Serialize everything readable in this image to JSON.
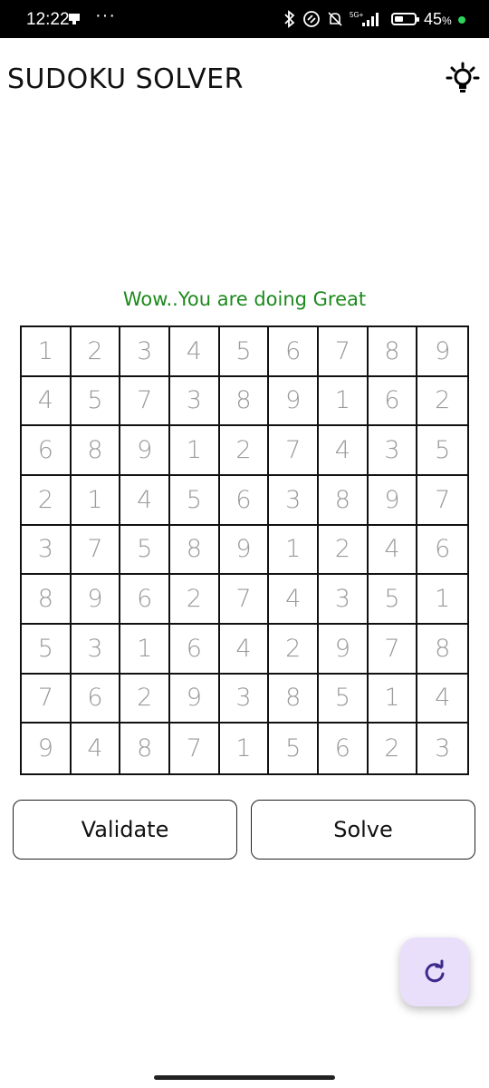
{
  "status_bar": {
    "time": "12:22",
    "dots": "···",
    "network": "5G+",
    "battery_percent": "45",
    "battery_symbol": "%",
    "battery_level": 0.45,
    "dot_color": "#2ed35a"
  },
  "header": {
    "title": "SUDOKU SOLVER",
    "theme_icon": "lightbulb-icon"
  },
  "message": {
    "text": "Wow..You are doing Great",
    "color": "#1c8a1c"
  },
  "board": {
    "rows": [
      [
        "1",
        "2",
        "3",
        "4",
        "5",
        "6",
        "7",
        "8",
        "9"
      ],
      [
        "4",
        "5",
        "7",
        "3",
        "8",
        "9",
        "1",
        "6",
        "2"
      ],
      [
        "6",
        "8",
        "9",
        "1",
        "2",
        "7",
        "4",
        "3",
        "5"
      ],
      [
        "2",
        "1",
        "4",
        "5",
        "6",
        "3",
        "8",
        "9",
        "7"
      ],
      [
        "3",
        "7",
        "5",
        "8",
        "9",
        "1",
        "2",
        "4",
        "6"
      ],
      [
        "8",
        "9",
        "6",
        "2",
        "7",
        "4",
        "3",
        "5",
        "1"
      ],
      [
        "5",
        "3",
        "1",
        "6",
        "4",
        "2",
        "9",
        "7",
        "8"
      ],
      [
        "7",
        "6",
        "2",
        "9",
        "3",
        "8",
        "5",
        "1",
        "4"
      ],
      [
        "9",
        "4",
        "8",
        "7",
        "1",
        "5",
        "6",
        "2",
        "3"
      ]
    ]
  },
  "actions": {
    "validate_label": "Validate",
    "solve_label": "Solve"
  },
  "fab": {
    "icon": "refresh-icon",
    "color": "#e9dffb"
  }
}
